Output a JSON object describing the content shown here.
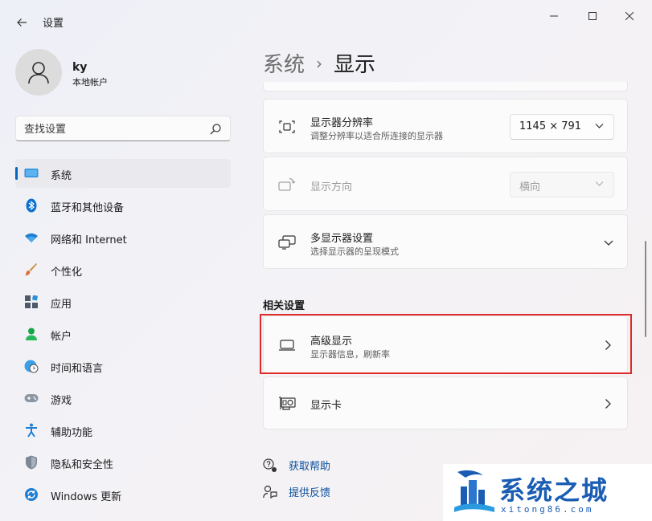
{
  "window": {
    "app_title": "设置",
    "controls": {
      "minimize": "minimize",
      "maximize": "maximize",
      "close": "close"
    }
  },
  "user": {
    "name": "ky",
    "account_type": "本地帐户"
  },
  "search": {
    "placeholder": "查找设置"
  },
  "sidebar": {
    "items": [
      {
        "label": "系统",
        "icon": "system-monitor-icon",
        "active": true
      },
      {
        "label": "蓝牙和其他设备",
        "icon": "bluetooth-icon",
        "active": false
      },
      {
        "label": "网络和 Internet",
        "icon": "wifi-icon",
        "active": false
      },
      {
        "label": "个性化",
        "icon": "brush-icon",
        "active": false
      },
      {
        "label": "应用",
        "icon": "apps-icon",
        "active": false
      },
      {
        "label": "帐户",
        "icon": "account-icon",
        "active": false
      },
      {
        "label": "时间和语言",
        "icon": "clock-globe-icon",
        "active": false
      },
      {
        "label": "游戏",
        "icon": "gamepad-icon",
        "active": false
      },
      {
        "label": "辅助功能",
        "icon": "accessibility-icon",
        "active": false
      },
      {
        "label": "隐私和安全性",
        "icon": "shield-icon",
        "active": false
      },
      {
        "label": "Windows 更新",
        "icon": "update-icon",
        "active": false
      }
    ]
  },
  "breadcrumb": {
    "parent": "系统",
    "separator": "›",
    "current": "显示"
  },
  "settings": {
    "resolution": {
      "title": "显示器分辨率",
      "subtitle": "调整分辨率以适合所连接的显示器",
      "value": "1145 × 791"
    },
    "orientation": {
      "title": "显示方向",
      "value": "横向",
      "disabled": true
    },
    "multi_display": {
      "title": "多显示器设置",
      "subtitle": "选择显示器的呈现模式"
    }
  },
  "related": {
    "section_title": "相关设置",
    "advanced_display": {
      "title": "高级显示",
      "subtitle": "显示器信息，刷新率"
    },
    "graphics": {
      "title": "显示卡"
    }
  },
  "help": {
    "get_help": "获取帮助",
    "feedback": "提供反馈"
  },
  "watermark": {
    "brand": "系统之城",
    "url": "xitong86.com"
  },
  "colors": {
    "accent": "#0067c0",
    "highlight_border": "#e0292a",
    "link": "#0a4f9c"
  }
}
